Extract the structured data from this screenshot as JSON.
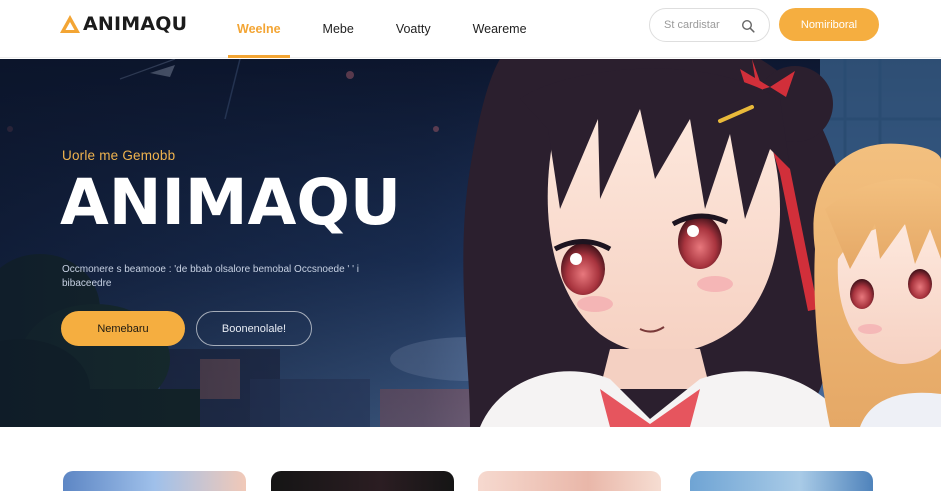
{
  "brand": {
    "name": "ANIMAQU"
  },
  "nav": {
    "items": [
      {
        "label": "Weelne",
        "active": true
      },
      {
        "label": "Mebe",
        "active": false
      },
      {
        "label": "Voatty",
        "active": false
      },
      {
        "label": "Weareme",
        "active": false
      }
    ]
  },
  "search": {
    "placeholder": "St cardistar"
  },
  "header": {
    "signup_label": "Nomiriboral"
  },
  "hero": {
    "eyebrow": "Uorle me Gemobb",
    "title": "ANIMAQU",
    "description": "Occmonere s beamooe : 'de bbab olsalore bemobal Occsnoede ' ' i bibaceedre",
    "primary_button": "Nemebaru",
    "secondary_button": "Boonenolale!"
  },
  "colors": {
    "accent": "#f5ae40",
    "hero_dark": "#0f1a33"
  }
}
